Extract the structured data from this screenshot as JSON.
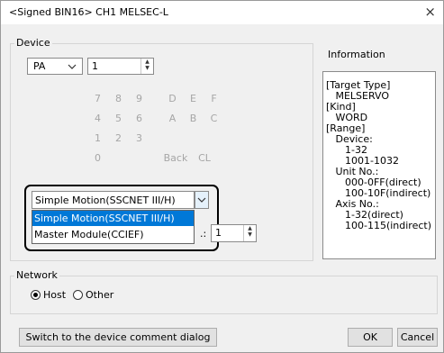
{
  "window": {
    "title": "<Signed BIN16> CH1 MELSEC-L",
    "close_glyph": "×"
  },
  "device_group": {
    "label": "Device",
    "device_select": "PA",
    "number_value": "1",
    "keypad": [
      "7",
      "8",
      "9",
      "D",
      "E",
      "F",
      "4",
      "5",
      "6",
      "A",
      "B",
      "C",
      "1",
      "2",
      "3",
      "0",
      "Back",
      "CL"
    ]
  },
  "module_select": {
    "value": "Simple Motion(SSCNET III/H)",
    "options": [
      "Simple Motion(SSCNET III/H)",
      "Master Module(CCIEF)"
    ],
    "hidden_label_suffix": ".:",
    "axis_value": "1"
  },
  "information": {
    "label": "Information",
    "lines": [
      "[Target Type]",
      "   MELSERVO",
      "[Kind]",
      "   WORD",
      "[Range]",
      "   Device:",
      "      1-32",
      "      1001-1032",
      "   Unit No.:",
      "      000-0FF(direct)",
      "      100-10F(indirect)",
      "   Axis No.:",
      "      1-32(direct)",
      "      100-115(indirect)"
    ]
  },
  "network": {
    "label": "Network",
    "host_label": "Host",
    "other_label": "Other",
    "selected": "Host"
  },
  "footer": {
    "switch_label": "Switch to the device comment dialog",
    "ok_label": "OK",
    "cancel_label": "Cancel"
  },
  "icons": {
    "chevron": "chevron-down-icon",
    "spin": "spin-updown-icon",
    "close": "close-icon"
  },
  "colors": {
    "highlight": "#0078d7",
    "callout_border": "#000000"
  }
}
